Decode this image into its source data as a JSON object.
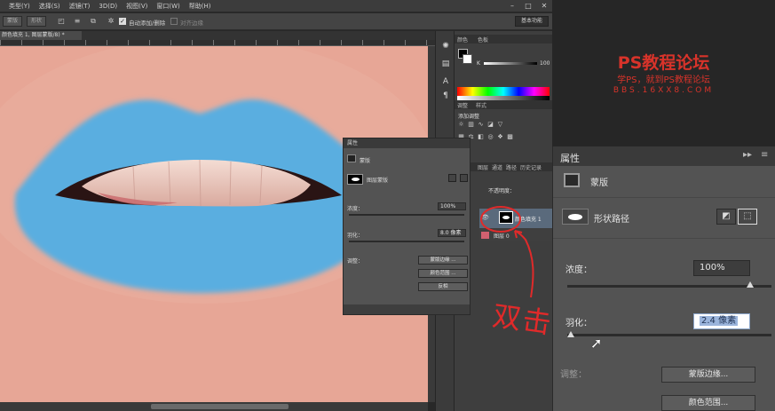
{
  "menu": {
    "items": [
      "类型(Y)",
      "选择(S)",
      "滤镜(T)",
      "3D(D)",
      "视图(V)",
      "窗口(W)",
      "帮助(H)"
    ]
  },
  "options_bar": {
    "btn_mask": "蒙版",
    "btn_shape": "形状",
    "auto_add_delete": "自动添加/删除",
    "align_edges": "对齐边缘",
    "workspace": "基本功能"
  },
  "document": {
    "tab_title": "颜色填充 1, 图层蒙版/8) *"
  },
  "panels": {
    "color_tabs": [
      "颜色",
      "色板"
    ],
    "k_value": "100",
    "adjust_tabs": [
      "调整",
      "样式"
    ],
    "adjust_title": "添加调整",
    "layer_tabs": [
      "图层",
      "通道",
      "路径",
      "历史记录"
    ],
    "opacity_label": "不透明度：",
    "layers": [
      {
        "name": "颜色填充 1"
      },
      {
        "name": "图层 0"
      }
    ]
  },
  "small_properties": {
    "title": "属性",
    "section": "蒙版",
    "mask_type": "图层蒙版",
    "density_label": "浓度：",
    "density_value": "100%",
    "feather_label": "羽化：",
    "feather_value": "8.0 像素",
    "adjust_label": "调整：",
    "btn_mask_edge": "蒙版边缘 ...",
    "btn_color_range": "颜色范围 ...",
    "btn_invert": "反相"
  },
  "watermark": {
    "title": "PS教程论坛",
    "line2": "学PS，就到PS教程论坛",
    "line3": "BBS.16XX8.COM"
  },
  "annotation": {
    "text": "双击"
  },
  "big_properties": {
    "title": "属性",
    "section": "蒙版",
    "subsection": "形状路径",
    "density_label": "浓度：",
    "density_value": "100%",
    "feather_label": "羽化：",
    "feather_value": "2.4 像素",
    "adjust_label": "调整：",
    "btn_mask_edge": "蒙版边缘...",
    "btn_color_range": "颜色范围..."
  },
  "colors": {
    "lip_fill": "#5aaee0",
    "annotation_red": "#e02a2a",
    "watermark_red": "#d8332a"
  }
}
